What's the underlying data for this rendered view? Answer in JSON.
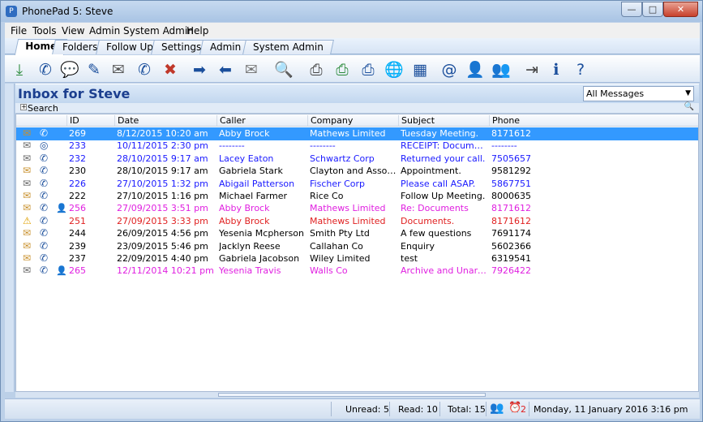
{
  "window": {
    "title": "PhonePad 5: Steve",
    "app_icon": "P"
  },
  "menu": [
    "File",
    "Tools",
    "View",
    "Admin",
    "System Admin",
    "Help"
  ],
  "tabs": [
    "Home",
    "Folders",
    "Follow Up",
    "Settings",
    "Admin",
    "System Admin"
  ],
  "toolbar": [
    {
      "icon": "download-icon",
      "glyph": "⤓",
      "color": "#2a8a3a"
    },
    {
      "icon": "phone-icon",
      "glyph": "✆",
      "color": "#1b4f9c"
    },
    {
      "icon": "chat-icon",
      "glyph": "💬",
      "color": "#1b4f9c"
    },
    {
      "icon": "note-icon",
      "glyph": "✎",
      "color": "#1b4f9c"
    },
    {
      "icon": "mail-icon",
      "glyph": "✉",
      "color": "#555555"
    },
    {
      "icon": "phone-forward-icon",
      "glyph": "✆",
      "color": "#1b4f9c"
    },
    {
      "icon": "delete-message-icon",
      "glyph": "✖",
      "color": "#c0392b"
    },
    {
      "icon": "forward-message-icon",
      "glyph": "➡",
      "color": "#1b4f9c"
    },
    {
      "icon": "reply-message-icon",
      "glyph": "⬅",
      "color": "#1b4f9c"
    },
    {
      "icon": "archive-message-icon",
      "glyph": "✉",
      "color": "#777777"
    },
    {
      "icon": "search-icon",
      "glyph": "🔍",
      "color": "#1b4f9c"
    },
    {
      "icon": "print-icon",
      "glyph": "⎙",
      "color": "#444444"
    },
    {
      "icon": "print-check-icon",
      "glyph": "⎙",
      "color": "#2a8a3a"
    },
    {
      "icon": "print-down-icon",
      "glyph": "⎙",
      "color": "#1b4f9c"
    },
    {
      "icon": "web-message-icon",
      "glyph": "🌐",
      "color": "#1b4f9c"
    },
    {
      "icon": "calculator-icon",
      "glyph": "▦",
      "color": "#1b4f9c"
    },
    {
      "icon": "email-settings-icon",
      "glyph": "@",
      "color": "#1b4f9c"
    },
    {
      "icon": "user-help-icon",
      "glyph": "👤",
      "color": "#1b4f9c"
    },
    {
      "icon": "user-message-icon",
      "glyph": "👥",
      "color": "#1b4f9c"
    },
    {
      "icon": "logout-icon",
      "glyph": "⇥",
      "color": "#444444"
    },
    {
      "icon": "info-icon",
      "glyph": "ℹ",
      "color": "#1b4f9c"
    },
    {
      "icon": "help-icon",
      "glyph": "?",
      "color": "#1b4f9c"
    }
  ],
  "inbox": {
    "title": "Inbox for Steve",
    "filter": "All Messages",
    "search_label": "Search"
  },
  "columns": [
    "ID",
    "Date",
    "Caller",
    "Company",
    "Subject",
    "Phone"
  ],
  "rows": [
    {
      "id": "269",
      "date": "8/12/2015 10:20 am",
      "caller": "Abby Brock",
      "company": "Mathews Limited",
      "subject": "Tuesday Meeting.",
      "phone": "8171612",
      "color": "#ffffff",
      "mail": "open-mail",
      "phone_icon": true,
      "user_icon": false,
      "selected": true
    },
    {
      "id": "233",
      "date": "10/11/2015 2:30 pm",
      "caller": "--------",
      "company": "--------",
      "subject": "RECEIPT: Documents f...",
      "phone": "--------",
      "color": "#1a1aff",
      "mail": "closed-mail",
      "phone_icon": false,
      "user_icon": false,
      "selected": false
    },
    {
      "id": "232",
      "date": "28/10/2015 9:17 am",
      "caller": "Lacey Eaton",
      "company": "Schwartz Corp",
      "subject": "Returned your call.",
      "phone": "7505657",
      "color": "#1a1aff",
      "mail": "closed-mail",
      "phone_icon": true,
      "user_icon": false,
      "selected": false
    },
    {
      "id": "230",
      "date": "28/10/2015 9:17 am",
      "caller": "Gabriela Stark",
      "company": "Clayton and Associates",
      "subject": "Appointment.",
      "phone": "9581292",
      "color": "#000000",
      "mail": "open-mail",
      "phone_icon": true,
      "user_icon": false,
      "selected": false
    },
    {
      "id": "226",
      "date": "27/10/2015 1:32 pm",
      "caller": "Abigail Patterson",
      "company": "Fischer Corp",
      "subject": "Please call ASAP.",
      "phone": "5867751",
      "color": "#1a1aff",
      "mail": "closed-mail",
      "phone_icon": true,
      "user_icon": false,
      "selected": false
    },
    {
      "id": "222",
      "date": "27/10/2015 1:16 pm",
      "caller": "Michael Farmer",
      "company": "Rice Co",
      "subject": "Follow Up Meeting.",
      "phone": "8000635",
      "color": "#000000",
      "mail": "open-mail",
      "phone_icon": true,
      "user_icon": false,
      "selected": false
    },
    {
      "id": "256",
      "date": "27/09/2015 3:51 pm",
      "caller": "Abby Brock",
      "company": "Mathews Limited",
      "subject": "Re: Documents",
      "phone": "8171612",
      "color": "#e020e0",
      "mail": "open-mail",
      "phone_icon": true,
      "user_icon": true,
      "selected": false
    },
    {
      "id": "251",
      "date": "27/09/2015 3:33 pm",
      "caller": "Abby Brock",
      "company": "Mathews Limited",
      "subject": "Documents.",
      "phone": "8171612",
      "color": "#e02020",
      "mail": "warning",
      "phone_icon": true,
      "user_icon": false,
      "selected": false
    },
    {
      "id": "244",
      "date": "26/09/2015 4:56 pm",
      "caller": "Yesenia Mcpherson",
      "company": "Smith Pty Ltd",
      "subject": "A few questions",
      "phone": "7691174",
      "color": "#000000",
      "mail": "open-mail",
      "phone_icon": true,
      "user_icon": false,
      "selected": false
    },
    {
      "id": "239",
      "date": "23/09/2015 5:46 pm",
      "caller": "Jacklyn Reese",
      "company": "Callahan Co",
      "subject": "Enquiry",
      "phone": "5602366",
      "color": "#000000",
      "mail": "open-mail",
      "phone_icon": true,
      "user_icon": false,
      "selected": false
    },
    {
      "id": "237",
      "date": "22/09/2015 4:40 pm",
      "caller": "Gabriela Jacobson",
      "company": "Wiley Limited",
      "subject": "test",
      "phone": "6319541",
      "color": "#000000",
      "mail": "open-mail",
      "phone_icon": true,
      "user_icon": false,
      "selected": false
    },
    {
      "id": "265",
      "date": "12/11/2014 10:21 pm",
      "caller": "Yesenia Travis",
      "company": "Walls Co",
      "subject": "Archive and Unarchive...",
      "phone": "7926422",
      "color": "#e020e0",
      "mail": "closed-mail",
      "phone_icon": true,
      "user_icon": true,
      "selected": false
    }
  ],
  "status": {
    "unread": "Unread: 5",
    "read": "Read: 10",
    "total": "Total: 15",
    "alarms": "2",
    "datetime": "Monday, 11 January 2016  3:16 pm"
  }
}
